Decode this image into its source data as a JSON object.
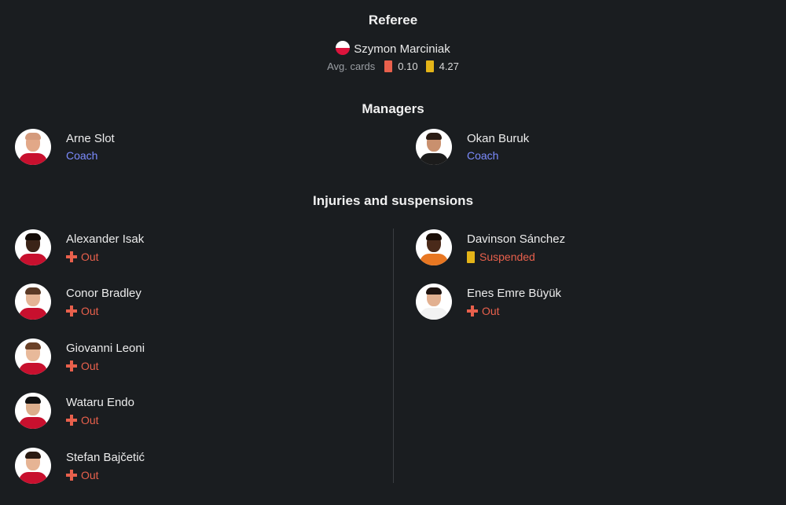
{
  "referee": {
    "title": "Referee",
    "name": "Szymon Marciniak",
    "flag_colors": [
      "#ffffff",
      "#dc143c"
    ],
    "avg_cards_label": "Avg. cards",
    "red_cards": "0.10",
    "yellow_cards": "4.27"
  },
  "managers": {
    "title": "Managers",
    "home": {
      "name": "Arne Slot",
      "role": "Coach"
    },
    "away": {
      "name": "Okan Buruk",
      "role": "Coach"
    }
  },
  "injuries": {
    "title": "Injuries and suspensions",
    "home": [
      {
        "name": "Alexander Isak",
        "status": "Out",
        "status_icon": "cross-icon"
      },
      {
        "name": "Conor Bradley",
        "status": "Out",
        "status_icon": "cross-icon"
      },
      {
        "name": "Giovanni Leoni",
        "status": "Out",
        "status_icon": "cross-icon"
      },
      {
        "name": "Wataru Endo",
        "status": "Out",
        "status_icon": "cross-icon"
      },
      {
        "name": "Stefan Bajčetić",
        "status": "Out",
        "status_icon": "cross-icon"
      }
    ],
    "away": [
      {
        "name": "Davinson Sánchez",
        "status": "Suspended",
        "status_icon": "yellow-card-icon"
      },
      {
        "name": "Enes Emre Büyük",
        "status": "Out",
        "status_icon": "cross-icon"
      }
    ]
  },
  "colors": {
    "background": "#1a1d20",
    "role_text": "#7c8cff",
    "status_text": "#e8604c",
    "yellow_card": "#e4b418",
    "red_card": "#e8604c"
  }
}
